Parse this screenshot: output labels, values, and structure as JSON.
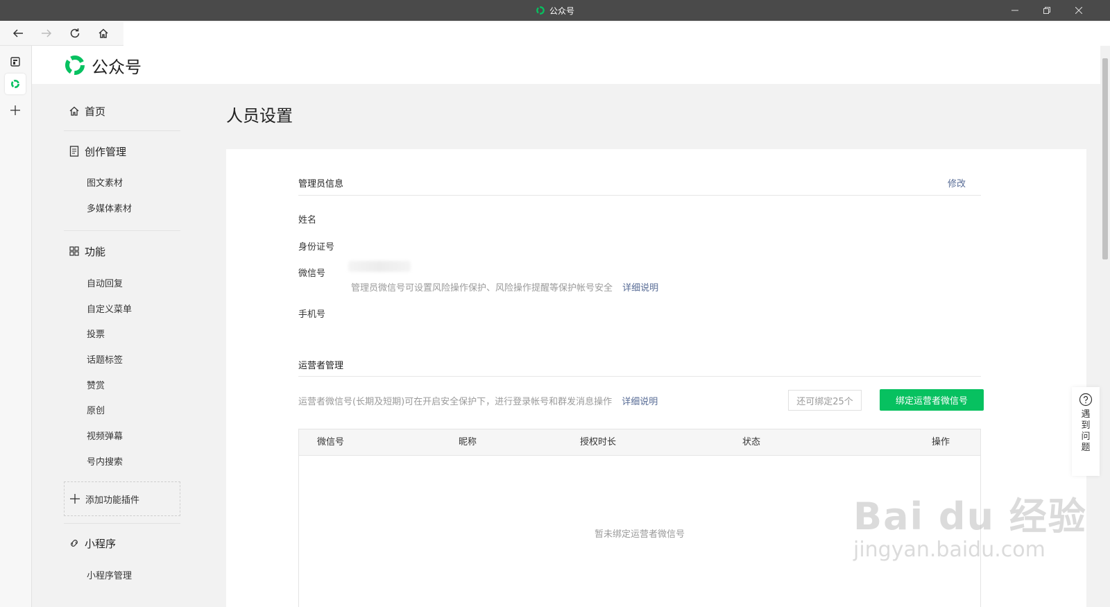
{
  "window": {
    "title": "公众号"
  },
  "app": {
    "name": "公众号"
  },
  "sidebar": {
    "home": "首页",
    "creation": {
      "label": "创作管理",
      "items": [
        "图文素材",
        "多媒体素材"
      ]
    },
    "features": {
      "label": "功能",
      "items": [
        "自动回复",
        "自定义菜单",
        "投票",
        "话题标签",
        "赞赏",
        "原创",
        "视频弹幕",
        "号内搜索"
      ]
    },
    "add_plugin": "添加功能插件",
    "miniprogram": {
      "label": "小程序",
      "items": [
        "小程序管理"
      ]
    }
  },
  "main": {
    "page_title": "人员设置",
    "admin": {
      "title": "管理员信息",
      "edit": "修改",
      "fields": {
        "name": "姓名",
        "id_number": "身份证号",
        "wechat": "微信号",
        "phone": "手机号"
      },
      "wechat_hint": "管理员微信号可设置风险操作保护、风险操作提醒等保护帐号安全",
      "details_link": "详细说明"
    },
    "operators": {
      "title": "运营者管理",
      "hint": "运营者微信号(长期及短期)可在开启安全保护下，进行登录帐号和群发消息操作",
      "details_link": "详细说明",
      "remaining": "还可绑定25个",
      "bind_button": "绑定运营者微信号",
      "columns": [
        "微信号",
        "昵称",
        "授权时长",
        "状态",
        "操作"
      ],
      "empty": "暂未绑定运营者微信号"
    }
  },
  "help": {
    "label": "遇到问题"
  },
  "watermark": {
    "brand": "Bai du 经验",
    "url": "jingyan.baidu.com"
  },
  "colors": {
    "accent": "#07c160",
    "link": "#576b95"
  }
}
